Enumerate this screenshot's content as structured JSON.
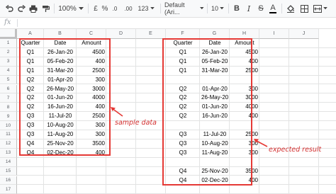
{
  "toolbar": {
    "zoom": "100%",
    "currency": "£",
    "percent": "%",
    "decimal_dec": ".0",
    "decimal_inc": ".00",
    "format_more": "123",
    "font": "Default (Ari...",
    "font_size": "10",
    "bold": "B",
    "italic": "I",
    "strike": "S",
    "text_color": "A"
  },
  "formula_bar": {
    "fx": "fx",
    "value": ""
  },
  "columns": [
    "A",
    "B",
    "C",
    "D",
    "E",
    "F",
    "G",
    "H",
    "I",
    "J"
  ],
  "rows": [
    "1",
    "2",
    "3",
    "4",
    "5",
    "6",
    "7",
    "8",
    "9",
    "10",
    "11",
    "12",
    "13",
    "14",
    "15",
    "16",
    "17"
  ],
  "sample": [
    [
      "Quarter",
      "Date",
      "Amount"
    ],
    [
      "Q1",
      "26-Jan-20",
      "4500"
    ],
    [
      "Q1",
      "05-Feb-20",
      "400"
    ],
    [
      "Q1",
      "31-Mar-20",
      "2500"
    ],
    [
      "Q2",
      "01-Apr-20",
      "300"
    ],
    [
      "Q2",
      "26-May-20",
      "3000"
    ],
    [
      "Q2",
      "01-Jun-20",
      "4000"
    ],
    [
      "Q2",
      "16-Jun-20",
      "400"
    ],
    [
      "Q3",
      "11-Jul-20",
      "2500"
    ],
    [
      "Q3",
      "10-Aug-20",
      "300"
    ],
    [
      "Q3",
      "11-Aug-20",
      "300"
    ],
    [
      "Q4",
      "25-Nov-20",
      "3500"
    ],
    [
      "Q4",
      "02-Dec-20",
      "400"
    ]
  ],
  "result": [
    [
      "Quarter",
      "Date",
      "Amount"
    ],
    [
      "Q1",
      "26-Jan-20",
      "4500"
    ],
    [
      "Q1",
      "05-Feb-20",
      "400"
    ],
    [
      "Q1",
      "31-Mar-20",
      "2500"
    ],
    [
      "",
      "",
      ""
    ],
    [
      "Q2",
      "01-Apr-20",
      "300"
    ],
    [
      "Q2",
      "26-May-20",
      "3000"
    ],
    [
      "Q2",
      "01-Jun-20",
      "4000"
    ],
    [
      "Q2",
      "16-Jun-20",
      "400"
    ],
    [
      "",
      "",
      ""
    ],
    [
      "Q3",
      "11-Jul-20",
      "2500"
    ],
    [
      "Q3",
      "10-Aug-20",
      "300"
    ],
    [
      "Q3",
      "11-Aug-20",
      "300"
    ],
    [
      "",
      "",
      ""
    ],
    [
      "Q4",
      "25-Nov-20",
      "3500"
    ],
    [
      "Q4",
      "02-Dec-20",
      "400"
    ]
  ],
  "annotations": {
    "sample_label": "sample data",
    "result_label": "expected result",
    "accent": "#e53935"
  }
}
